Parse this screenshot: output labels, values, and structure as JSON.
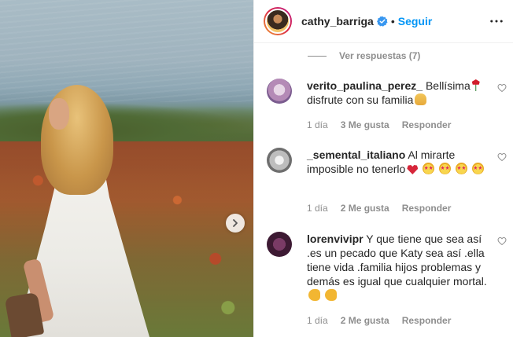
{
  "photo": {
    "alt": "",
    "next_icon": "chevron-right-icon"
  },
  "header": {
    "username": "cathy_barriga",
    "verified_icon": "verified-badge-icon",
    "separator": "•",
    "follow_label": "Seguir",
    "more_icon": "more-options-icon"
  },
  "replies": {
    "label": "Ver respuestas (7)"
  },
  "comments": [
    {
      "username": "verito_paulina_perez_",
      "text_a": "Bellísima",
      "text_b": "disfrute con su familia",
      "emojis": [
        "rose",
        "pray"
      ],
      "time": "1 día",
      "likes": "3 Me gusta",
      "reply_label": "Responder"
    },
    {
      "username": "_semental_italiano",
      "text_a": "Al mirarte imposible no tenerlo",
      "emojis": [
        "heart",
        "star-struck",
        "star-struck",
        "star-struck",
        "star-struck"
      ],
      "time": "1 día",
      "likes": "2 Me gusta",
      "reply_label": "Responder"
    },
    {
      "username": "lorenvivipr",
      "text_a": "Y que tiene que sea así .es un pecado que Katy sea así .ella tiene vida .familia hijos problemas y demás es igual que cualquier mortal.",
      "emojis": [
        "muscle",
        "muscle"
      ],
      "time": "1 día",
      "likes": "2 Me gusta",
      "reply_label": "Responder"
    }
  ],
  "colors": {
    "link_blue": "#0095f6",
    "secondary_text": "#8e8e8e",
    "primary_text": "#262626",
    "divider": "#efefef"
  }
}
